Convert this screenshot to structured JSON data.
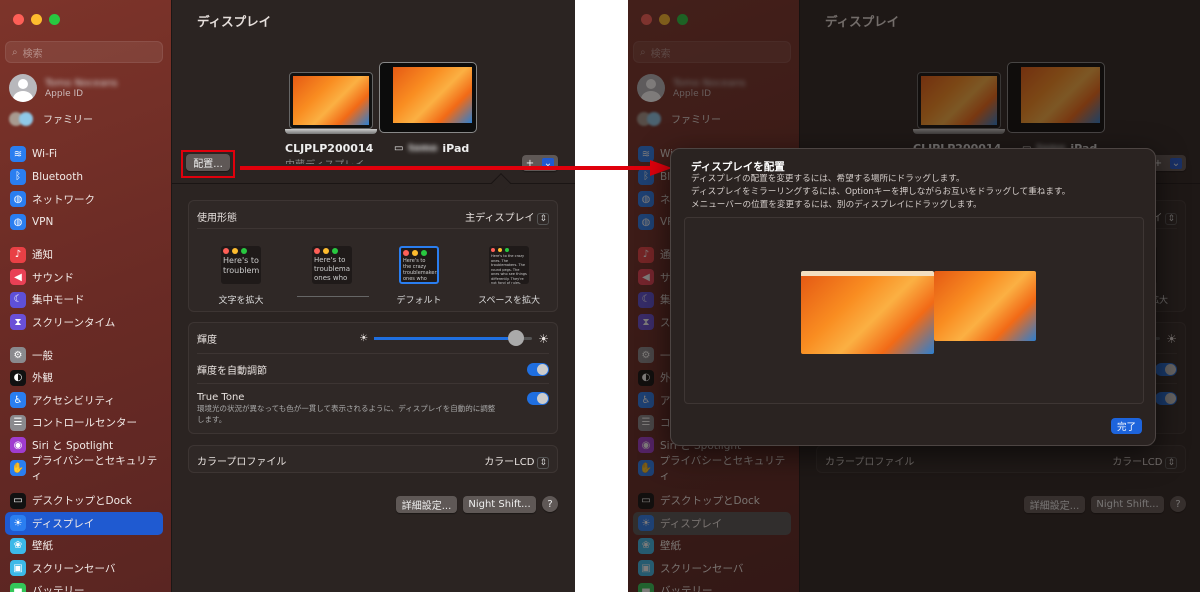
{
  "sidebar": {
    "search_placeholder": "検索",
    "account": {
      "name": "Tomo Noceans",
      "sub": "Apple ID"
    },
    "family": "ファミリー",
    "groups": [
      [
        {
          "label": "Wi-Fi",
          "icon": "wifi-icon",
          "glyph": "≋",
          "color": "#2a7ef0"
        },
        {
          "label": "Bluetooth",
          "icon": "bluetooth-icon",
          "glyph": "ᛒ",
          "color": "#2a7ef0"
        },
        {
          "label": "ネットワーク",
          "icon": "globe-icon",
          "glyph": "◍",
          "color": "#2a7ef0"
        },
        {
          "label": "VPN",
          "icon": "vpn-globe-icon",
          "glyph": "◍",
          "color": "#2a7ef0"
        }
      ],
      [
        {
          "label": "通知",
          "icon": "bell-icon",
          "glyph": "♪",
          "color": "#e94045"
        },
        {
          "label": "サウンド",
          "icon": "speaker-icon",
          "glyph": "◀",
          "color": "#e94055"
        },
        {
          "label": "集中モード",
          "icon": "moon-icon",
          "glyph": "☾",
          "color": "#5e50d8"
        },
        {
          "label": "スクリーンタイム",
          "icon": "hourglass-icon",
          "glyph": "⧗",
          "color": "#6a50d8"
        }
      ],
      [
        {
          "label": "一般",
          "icon": "gear-icon",
          "glyph": "⚙",
          "color": "#8a8a8e"
        },
        {
          "label": "外観",
          "icon": "appearance-icon",
          "glyph": "◐",
          "color": "#111"
        },
        {
          "label": "アクセシビリティ",
          "icon": "accessibility-icon",
          "glyph": "♿",
          "color": "#2a7ef0"
        },
        {
          "label": "コントロールセンター",
          "icon": "control-center-icon",
          "glyph": "☰",
          "color": "#8a8a8e"
        },
        {
          "label": "Siri と Spotlight",
          "icon": "siri-icon",
          "glyph": "◉",
          "color": "#a03ccf"
        },
        {
          "label": "プライバシーとセキュリティ",
          "icon": "hand-icon",
          "glyph": "✋",
          "color": "#2a7ef0"
        }
      ],
      [
        {
          "label": "デスクトップとDock",
          "icon": "dock-icon",
          "glyph": "▭",
          "color": "#111"
        },
        {
          "label": "ディスプレイ",
          "icon": "display-brightness-icon",
          "glyph": "☀",
          "color": "#2a7ef0",
          "selected": true
        },
        {
          "label": "壁紙",
          "icon": "wallpaper-icon",
          "glyph": "❀",
          "color": "#3cb9e8"
        },
        {
          "label": "スクリーンセーバ",
          "icon": "screensaver-icon",
          "glyph": "▣",
          "color": "#3cb9e8"
        },
        {
          "label": "バッテリー",
          "icon": "battery-icon",
          "glyph": "▬",
          "color": "#34c759"
        }
      ]
    ]
  },
  "main": {
    "title": "ディスプレイ",
    "arrange_button": "配置...",
    "displays": [
      {
        "name": "CLJPLP200014",
        "subtitle": "内蔵ディスプレイ"
      },
      {
        "owner": "tomo",
        "name": "iPad"
      }
    ],
    "add_button": "+",
    "usage": {
      "label": "使用形態",
      "value": "主ディスプレイ",
      "options": [
        {
          "label": "文字を拡大",
          "sample": "Here's to troublem"
        },
        {
          "label": "",
          "sample": "Here's to troublema ones who"
        },
        {
          "label": "デフォルト",
          "sample": "Here's to the crazy troublemakers, ones who see rules. And they"
        },
        {
          "label": "スペースを拡大",
          "sample": "Here's to the crazy ones. The troublemakers. The round pegs. The ones who see things differently. They're not fond of rules."
        }
      ]
    },
    "brightness": {
      "label": "輝度",
      "level": 0.9
    },
    "auto_brightness": {
      "label": "輝度を自動調節",
      "on": true
    },
    "true_tone": {
      "label": "True Tone",
      "description": "環境光の状況が異なっても色が一貫して表示されるように、ディスプレイを自動的に調整します。",
      "on": true
    },
    "color_profile": {
      "label": "カラープロファイル",
      "value": "カラーLCD"
    },
    "advanced_button": "詳細設定...",
    "night_shift_button": "Night Shift...",
    "help_button": "?"
  },
  "dialog": {
    "title": "ディスプレイを配置",
    "lines": [
      "ディスプレイの配置を変更するには、希望する場所にドラッグします。",
      "ディスプレイをミラーリングするには、Optionキーを押しながらお互いをドラッグして重ねます。",
      "メニューバーの位置を変更するには、別のディスプレイにドラッグします。"
    ],
    "done_button": "完了"
  },
  "colors": {
    "accent": "#1f5ad1",
    "highlight": "#e0000c"
  }
}
